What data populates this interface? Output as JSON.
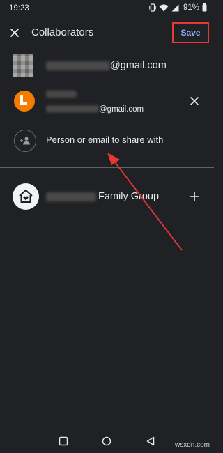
{
  "status_bar": {
    "time": "19:23",
    "battery": "91%"
  },
  "header": {
    "title": "Collaborators",
    "save_label": "Save"
  },
  "collaborators": [
    {
      "email_suffix": "@gmail.com"
    },
    {
      "email_suffix": "@gmail.com"
    }
  ],
  "share": {
    "placeholder": "Person or email to share with"
  },
  "family_group": {
    "label": "Family Group"
  },
  "watermark": "wsxdn.com",
  "colors": {
    "background": "#202124",
    "accent": "#8ab4f8",
    "annotation": "#e53935",
    "orange_avatar": "#f57c00"
  },
  "icons": [
    "close-icon",
    "person-add-icon",
    "plus-icon",
    "home-heart-icon",
    "square-icon",
    "circle-icon",
    "triangle-back-icon"
  ]
}
